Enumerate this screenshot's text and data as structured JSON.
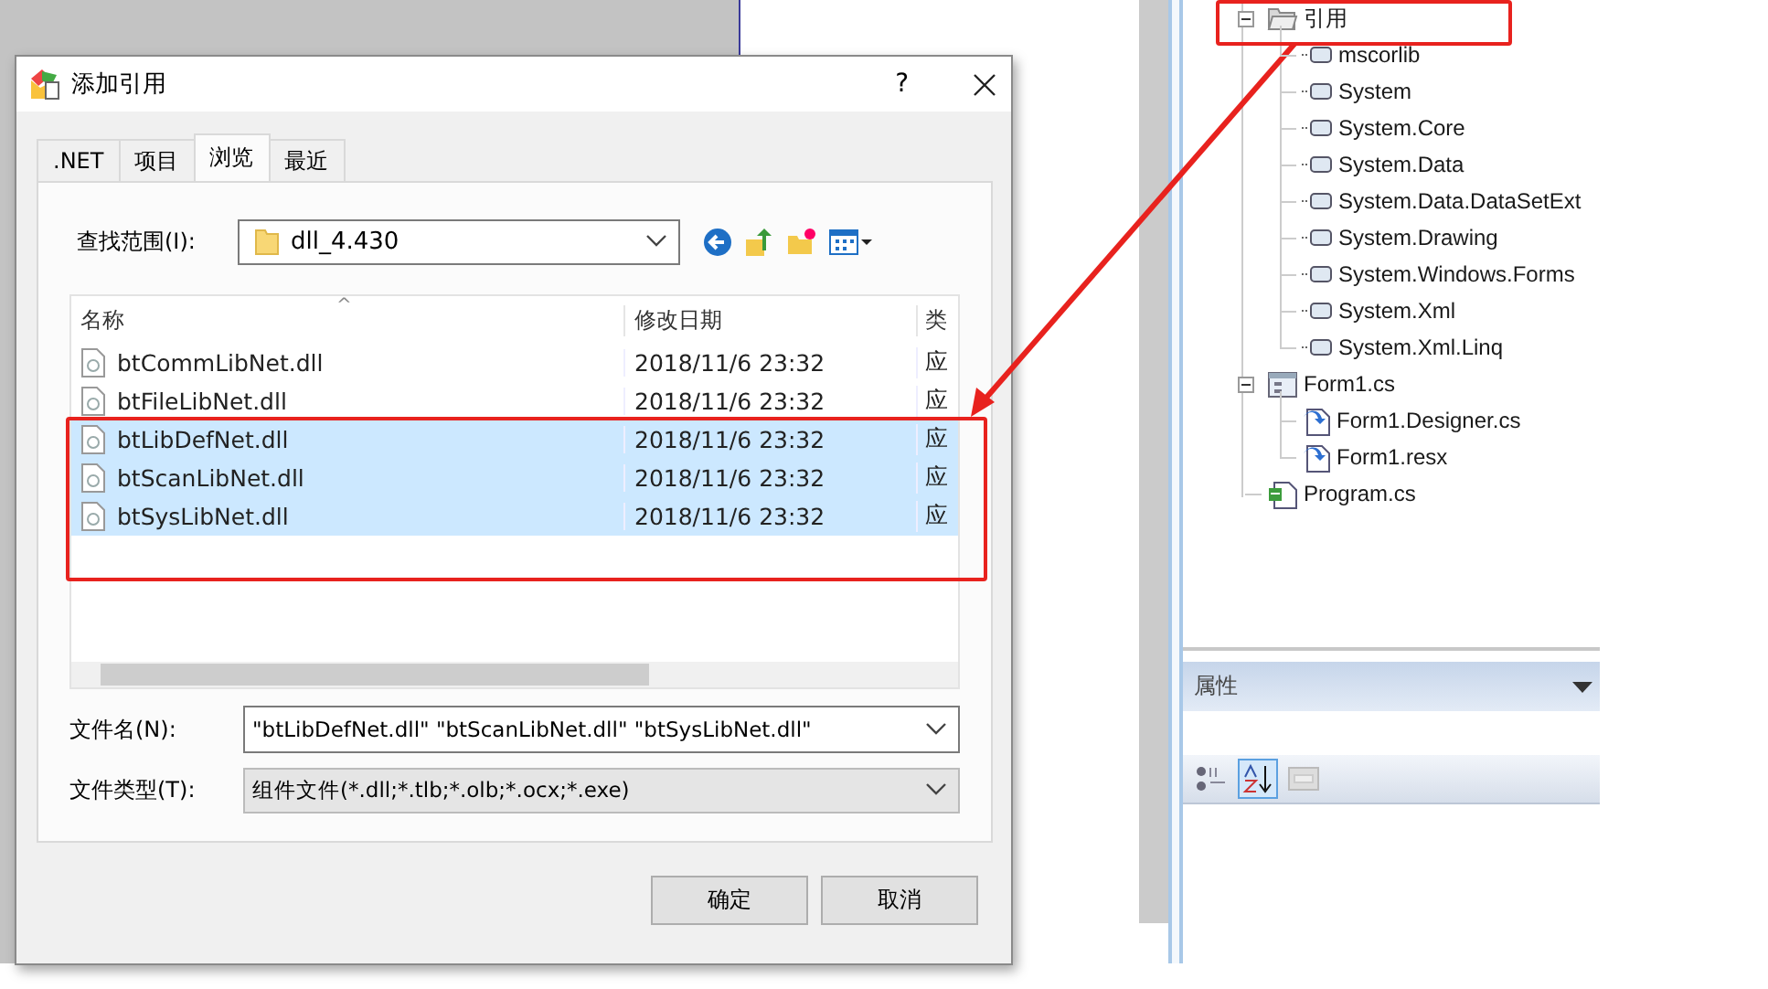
{
  "dialog": {
    "title": "添加引用",
    "help": "?",
    "tabs": [
      {
        "label": ".NET",
        "selected": false
      },
      {
        "label": "项目",
        "selected": false
      },
      {
        "label": "浏览",
        "selected": true
      },
      {
        "label": "最近",
        "selected": false
      }
    ],
    "look_in": {
      "label": "查找范围(I):",
      "value": "dll_4.430"
    },
    "file_list": {
      "sort_mark": "^",
      "columns": [
        "名称",
        "修改日期",
        "类"
      ],
      "rows": [
        {
          "name": "btCommLibNet.dll",
          "date": "2018/11/6 23:32",
          "column_3": "应",
          "selected": false
        },
        {
          "name": "btFileLibNet.dll",
          "date": "2018/11/6 23:32",
          "column_3": "应",
          "selected": false
        },
        {
          "name": "btLibDefNet.dll",
          "date": "2018/11/6 23:32",
          "column_3": "应",
          "selected": true
        },
        {
          "name": "btScanLibNet.dll",
          "date": "2018/11/6 23:32",
          "column_3": "应",
          "selected": true
        },
        {
          "name": "btSysLibNet.dll",
          "date": "2018/11/6 23:32",
          "column_3": "应",
          "selected": true
        }
      ]
    },
    "file_name": {
      "label": "文件名(N):",
      "value": "\"btLibDefNet.dll\" \"btScanLibNet.dll\" \"btSysLibNet.dll\""
    },
    "file_type": {
      "label": "文件类型(T):",
      "value": "组件文件(*.dll;*.tlb;*.olb;*.ocx;*.exe)"
    },
    "buttons": [
      "确定",
      "取消"
    ]
  },
  "solution_tree": [
    {
      "label": "引用",
      "kind": "folder",
      "expanded": true,
      "children": [
        {
          "label": "mscorlib",
          "kind": "reference"
        },
        {
          "label": "System",
          "kind": "reference"
        },
        {
          "label": "System.Core",
          "kind": "reference"
        },
        {
          "label": "System.Data",
          "kind": "reference"
        },
        {
          "label": "System.Data.DataSetExt",
          "kind": "reference"
        },
        {
          "label": "System.Drawing",
          "kind": "reference"
        },
        {
          "label": "System.Windows.Forms",
          "kind": "reference"
        },
        {
          "label": "System.Xml",
          "kind": "reference"
        },
        {
          "label": "System.Xml.Linq",
          "kind": "reference"
        }
      ]
    },
    {
      "label": "Form1.cs",
      "kind": "form",
      "expanded": true,
      "children": [
        {
          "label": "Form1.Designer.cs",
          "kind": "code"
        },
        {
          "label": "Form1.resx",
          "kind": "code"
        }
      ]
    },
    {
      "label": "Program.cs",
      "kind": "program"
    }
  ],
  "properties": {
    "title": "属性",
    "toolbar": [
      {
        "kind": "categorized",
        "selected": false
      },
      {
        "kind": "alphabetical",
        "selected": true
      },
      {
        "kind": "pages",
        "selected": false
      }
    ]
  }
}
